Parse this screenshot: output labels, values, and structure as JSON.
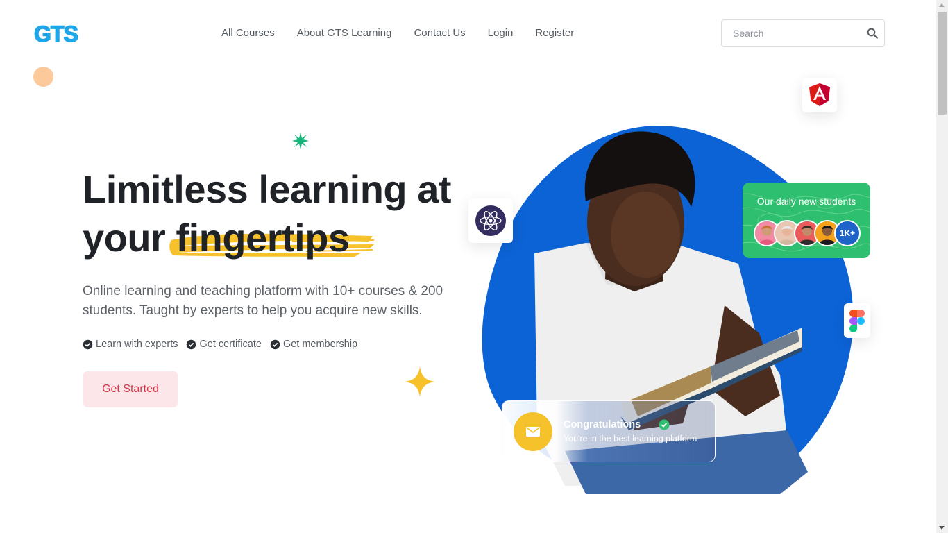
{
  "brand": {
    "logo_text": "GTS",
    "logo_color": "#1ea6e8"
  },
  "nav": {
    "items": [
      {
        "label": "All Courses"
      },
      {
        "label": "About GTS Learning"
      },
      {
        "label": "Contact Us"
      },
      {
        "label": "Login"
      },
      {
        "label": "Register"
      }
    ]
  },
  "search": {
    "placeholder": "Search",
    "icon": "search-icon"
  },
  "hero": {
    "title_line1": "Limitless learning at",
    "title_line2_plain": "your",
    "title_highlight": "fingertips",
    "description": "Online learning and teaching platform with 10+ courses & 200 students. Taught by experts to help you acquire new skills.",
    "features": [
      {
        "label": "Learn with experts",
        "icon": "check-badge-icon"
      },
      {
        "label": "Get certificate",
        "icon": "check-badge-icon"
      },
      {
        "label": "Get membership",
        "icon": "check-badge-icon"
      }
    ],
    "cta_label": "Get Started"
  },
  "students_card": {
    "title": "Our daily new students",
    "count_badge": "1K+"
  },
  "congrats_card": {
    "title": "Congratulations",
    "subtitle": "You're in the best learning platform"
  },
  "floating_icons": [
    "angular-icon",
    "atom-icon",
    "figma-icon"
  ],
  "colors": {
    "accent_blue": "#0c63d6",
    "highlight_yellow": "#f7c12b",
    "cta_bg": "#fce6e9",
    "cta_text": "#d63348",
    "students_green": "#2fbf71"
  }
}
